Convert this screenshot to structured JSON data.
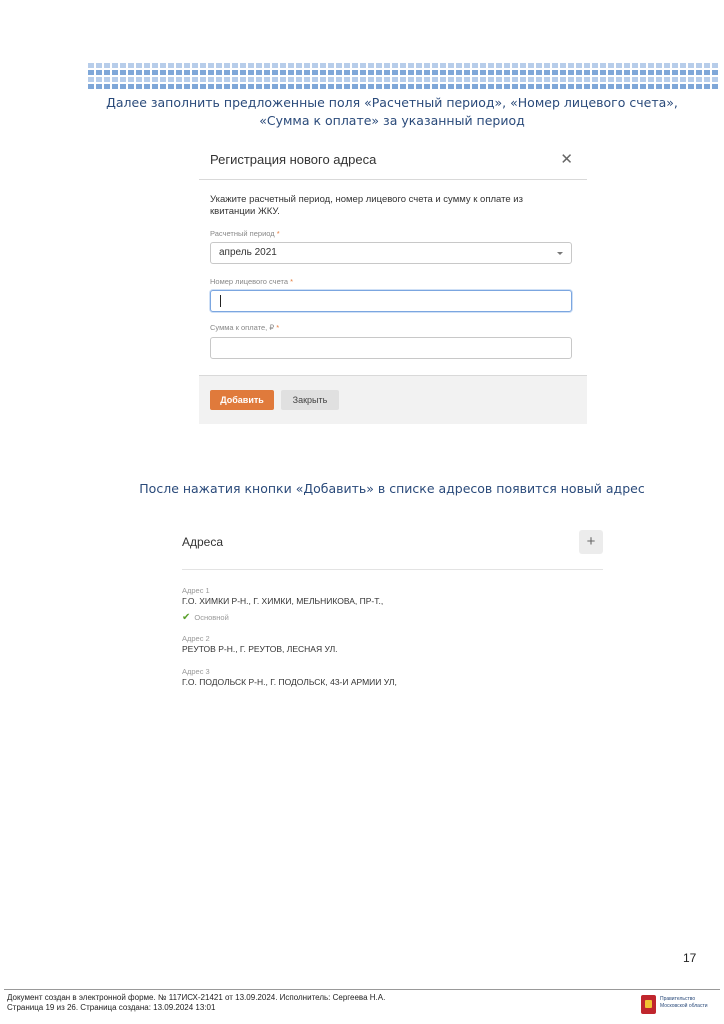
{
  "instructions": {
    "line1": "Далее заполнить предложенные поля «Расчетный период», «Номер лицевого счета»,",
    "line2": "«Сумма к оплате» за указанный период",
    "after": "После нажатия кнопки «Добавить» в списке адресов появится новый адрес"
  },
  "modal": {
    "title": "Регистрация нового адреса",
    "close_icon": "close-icon",
    "description": "Укажите расчетный период, номер лицевого счета и сумму к оплате из квитанции ЖКУ.",
    "fields": {
      "period_label": "Расчетный период",
      "period_value": "апрель 2021",
      "account_label": "Номер лицевого счета",
      "account_value": "",
      "amount_label": "Сумма к оплате, ₽",
      "amount_value": ""
    },
    "required_mark": "*",
    "add_button": "Добавить",
    "close_button": "Закрыть"
  },
  "addresses": {
    "title": "Адреса",
    "add_icon": "+",
    "items": [
      {
        "caption": "Адрес 1",
        "value": "Г.О. ХИМКИ Р-Н., Г. ХИМКИ, МЕЛЬНИКОВА, ПР-Т.,",
        "badge": "Основной"
      },
      {
        "caption": "Адрес 2",
        "value": "РЕУТОВ Р-Н., Г. РЕУТОВ, ЛЕСНАЯ УЛ."
      },
      {
        "caption": "Адрес 3",
        "value": "Г.О. ПОДОЛЬСК Р-Н., Г. ПОДОЛЬСК, 43-И АРМИИ УЛ,"
      }
    ]
  },
  "page_number": "17",
  "footer": {
    "line1": "Документ создан в электронной форме. № 117ИСХ-21421 от 13.09.2024. Исполнитель: Сергеева Н.А.",
    "line2": "Страница 19 из 26. Страница создана: 13.09.2024 13:01",
    "gov_line1": "Правительство",
    "gov_line2": "Московской области"
  },
  "colors": {
    "accent": "#e07a3b",
    "instruction_text": "#2a4a7a",
    "check": "#5aa02c"
  }
}
